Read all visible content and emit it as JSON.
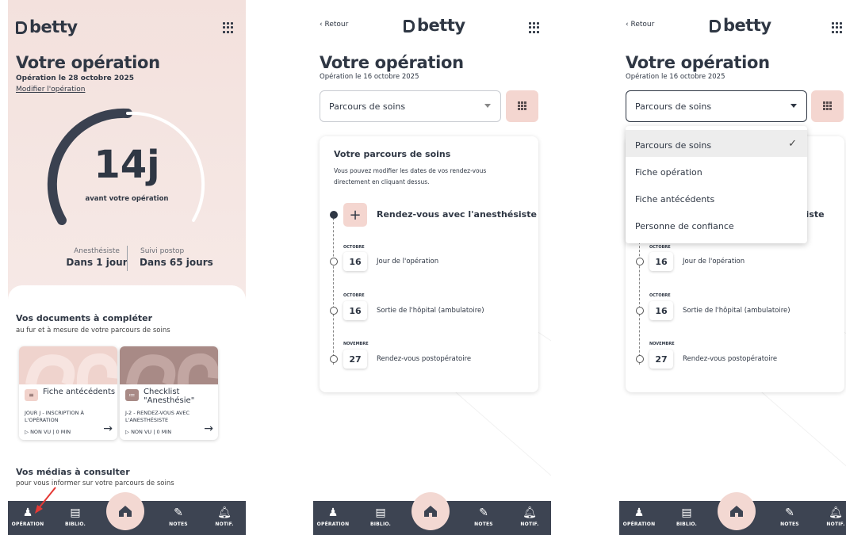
{
  "brand": {
    "name": "betty"
  },
  "screen1": {
    "title": "Votre opération",
    "date": "Opération le 28 octobre 2025",
    "modify_link": "Modifier l'opération",
    "countdown": "14j",
    "countdown_caption": "avant votre opération",
    "stats": [
      {
        "label": "Anesthésiste",
        "value": "Dans 1 jour"
      },
      {
        "label": "Suivi postop",
        "value": "Dans 65 jours"
      }
    ],
    "documents": {
      "title": "Vos documents à compléter",
      "subtitle": "au fur et à mesure de votre parcours de soins",
      "items": [
        {
          "name": "Fiche antécédents",
          "meta": "JOUR J - INSCRIPTION À L'OPÉRATION",
          "status": "▷ NON VU",
          "duration": "0 MIN"
        },
        {
          "name": "Checklist \"Anesthésie\"",
          "meta": "J-2 - RENDEZ-VOUS AVEC L'ANESTHÉSISTE",
          "status": "▷ NON VU",
          "duration": "0 MIN"
        }
      ]
    },
    "media": {
      "title": "Vos médias à consulter",
      "subtitle": "pour vous informer sur votre parcours de soins"
    }
  },
  "screen2": {
    "back": "Retour",
    "title": "Votre opération",
    "date": "Opération le 16 octobre 2025",
    "select_value": "Parcours de soins",
    "card": {
      "title": "Votre parcours de soins",
      "description": "Vous pouvez modifier les dates de vos rendez-vous directement en cliquant dessus.",
      "main_event": "Rendez-vous avec l'anesthésiste",
      "events": [
        {
          "month": "OCTOBRE",
          "day": "16",
          "label": "Jour de l'opération"
        },
        {
          "month": "OCTOBRE",
          "day": "16",
          "label": "Sortie de l'hôpital (ambulatoire)"
        },
        {
          "month": "NOVEMBRE",
          "day": "27",
          "label": "Rendez-vous postopératoire"
        }
      ]
    }
  },
  "screen3": {
    "dropdown_options": [
      "Parcours de soins",
      "Fiche opération",
      "Fiche antécédents",
      "Personne de confiance"
    ],
    "selected": "Parcours de soins",
    "peek_text": "siste"
  },
  "nav": {
    "items": [
      "OPÉRATION",
      "BIBLIO.",
      "NOTES",
      "NOTIF."
    ]
  },
  "colors": {
    "accent": "#f4d6d0",
    "dark": "#2f3744",
    "nav_bg": "#3d4452",
    "annotation": "#e53935"
  }
}
